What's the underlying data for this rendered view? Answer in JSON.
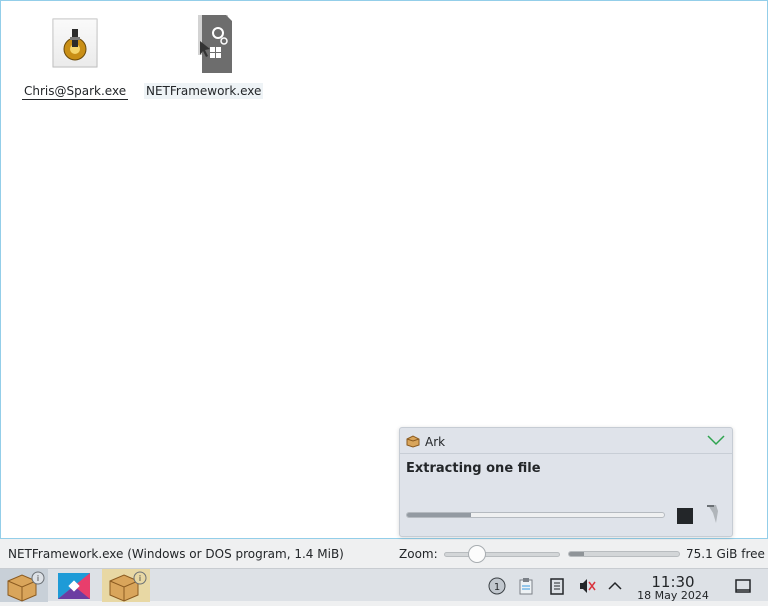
{
  "files": [
    {
      "name": "Chris@Spark.exe"
    },
    {
      "name": "NETFramework.exe"
    }
  ],
  "statusbar": {
    "info": "NETFramework.exe (Windows or DOS program, 1.4 MiB)",
    "zoom_label": "Zoom:",
    "free_space": "75.1 GiB free",
    "used_fraction": 0.14
  },
  "notification": {
    "app": "Ark",
    "title": "Extracting one file",
    "progress": 0.25
  },
  "taskbar": {
    "tasks": [
      "ark-icon",
      "kde-connect-icon",
      "ark-icon"
    ],
    "tray": [
      "updates-badge-icon",
      "clipboard-icon",
      "notes-icon",
      "audio-muted-icon",
      "chevron-up-icon"
    ],
    "update_count": "1",
    "time": "11:30",
    "date": "18 May 2024"
  },
  "colors": {
    "accent": "#93cee9",
    "notif_bg": "#dfe3ea"
  }
}
